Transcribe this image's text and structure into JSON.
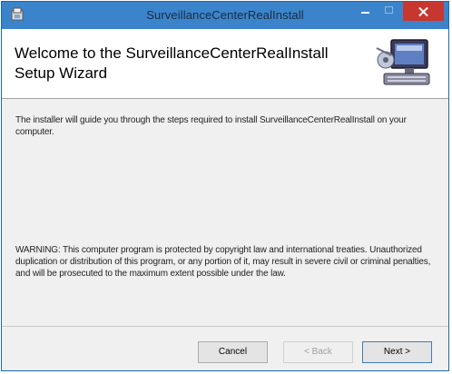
{
  "window": {
    "title": "SurveillanceCenterRealInstall",
    "accent": "#3b84cc",
    "close_color": "#c7372f",
    "controls": {
      "minimize_icon": "minimize-icon",
      "maximize_icon": "maximize-icon",
      "close_icon": "close-icon"
    }
  },
  "header": {
    "title": "Welcome to the SurveillanceCenterRealInstall Setup Wizard",
    "graphic_icon": "computer-setup-icon"
  },
  "body": {
    "intro": "The installer will guide you through the steps required to install SurveillanceCenterRealInstall on your computer.",
    "warning": "WARNING: This computer program is protected by copyright law and international treaties. Unauthorized duplication or distribution of this program, or any portion of it, may result in severe civil or criminal penalties, and will be prosecuted to the maximum extent possible under the law."
  },
  "buttons": {
    "cancel": "Cancel",
    "back": "< Back",
    "next": "Next >"
  }
}
